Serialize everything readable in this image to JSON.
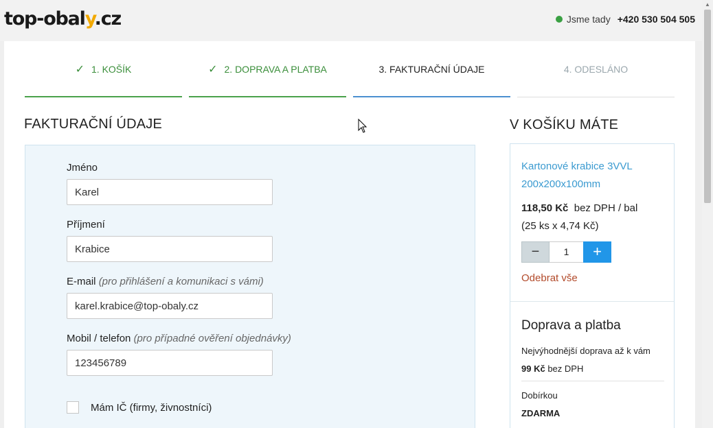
{
  "header": {
    "logo_main": "top-obal",
    "logo_y": "y",
    "logo_tld": ".cz",
    "status": "Jsme tady",
    "phone": "+420 530 504 505",
    "status_color": "#3aa043"
  },
  "steps": [
    {
      "label": "1. KOŠÍK",
      "state": "done"
    },
    {
      "label": "2. DOPRAVA A PLATBA",
      "state": "done"
    },
    {
      "label": "3. FAKTURAČNÍ ÚDAJE",
      "state": "active"
    },
    {
      "label": "4. ODESLÁNO",
      "state": "todo"
    }
  ],
  "billing": {
    "title": "FAKTURAČNÍ ÚDAJE",
    "first_name": {
      "label": "Jméno",
      "value": "Karel"
    },
    "last_name": {
      "label": "Příjmení",
      "value": "Krabice"
    },
    "email": {
      "label": "E-mail",
      "hint": "(pro přihlášení a komunikaci s vámi)",
      "value": "karel.krabice@top-obaly.cz"
    },
    "phone": {
      "label": "Mobil / telefon",
      "hint": "(pro případné ověření objednávky)",
      "value": "123456789"
    },
    "company_checkbox": {
      "label": "Mám IČ (firmy, živnostníci)",
      "checked": false
    }
  },
  "cart": {
    "title": "V KOŠÍKU MÁTE",
    "product": {
      "name_line1": "Kartonové krabice 3VVL",
      "name_line2": "200x200x100mm",
      "price": "118,50 Kč",
      "price_suffix": "bez DPH / bal",
      "pack_info": "(25 ks x 4,74 Kč)",
      "quantity": "1",
      "minus": "−",
      "plus": "+",
      "remove": "Odebrat vše"
    },
    "shipping": {
      "title": "Doprava a platba",
      "desc": "Nejvýhodnější doprava až k vám",
      "price": "99 Kč",
      "price_suffix": "bez DPH",
      "payment": "Dobírkou",
      "payment_price": "ZDARMA"
    }
  },
  "colors": {
    "done": "#49a14a",
    "active": "#4a8fd0",
    "link": "#3a9ad0",
    "remove": "#b24a2a",
    "plus_button": "#2196e8"
  }
}
